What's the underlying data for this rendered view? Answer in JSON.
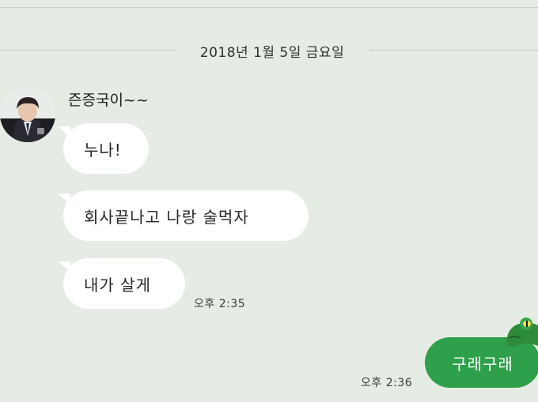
{
  "chat": {
    "date": "2018년 1월 5일 금요일",
    "sender_name": "즌증국이~~",
    "incoming": [
      {
        "text": "누나!"
      },
      {
        "text": "회사끝나고 나랑 술먹자"
      },
      {
        "text": "내가 살게"
      }
    ],
    "incoming_time": "오후 2:35",
    "outgoing": {
      "text": "구래구래",
      "time": "오후 2:36"
    }
  },
  "colors": {
    "background": "#e5ece4",
    "incoming_bubble": "#ffffff",
    "outgoing_bubble": "#2e9f4a",
    "sticker_frog": "#2f8b3c"
  },
  "icons": {
    "avatar": "profile-photo",
    "sticker": "frog-sticker"
  }
}
